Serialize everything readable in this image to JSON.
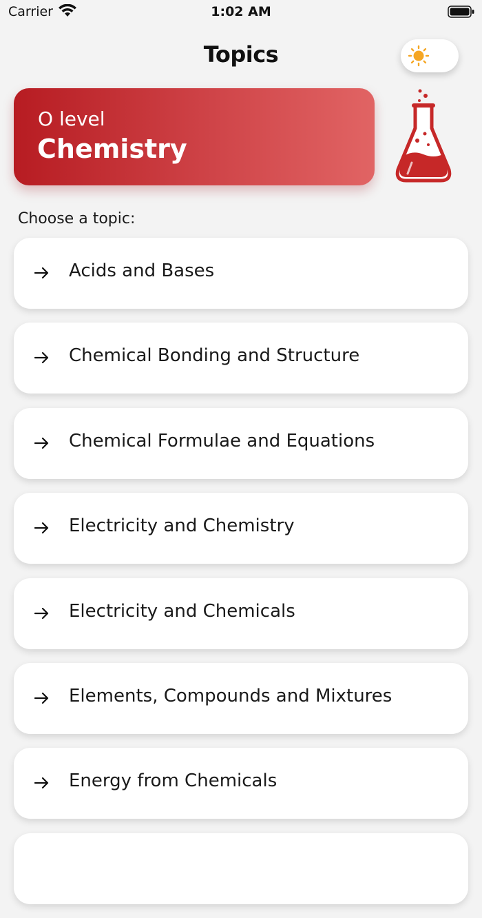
{
  "status_bar": {
    "carrier": "Carrier",
    "time": "1:02 AM"
  },
  "header": {
    "title": "Topics",
    "theme_toggle_icon": "sun-icon"
  },
  "banner": {
    "subtitle": "O level",
    "title": "Chemistry",
    "icon": "flask-icon"
  },
  "section_label": "Choose a topic:",
  "topics": [
    {
      "label": "Acids and Bases"
    },
    {
      "label": "Chemical Bonding and Structure"
    },
    {
      "label": "Chemical Formulae and Equations"
    },
    {
      "label": "Electricity and Chemistry"
    },
    {
      "label": "Electricity and Chemicals"
    },
    {
      "label": "Elements, Compounds and Mixtures"
    },
    {
      "label": "Energy from Chemicals"
    },
    {
      "label": ""
    }
  ],
  "colors": {
    "accent": "#c62828",
    "sun": "#f5a623",
    "background": "#f3f3f3"
  }
}
